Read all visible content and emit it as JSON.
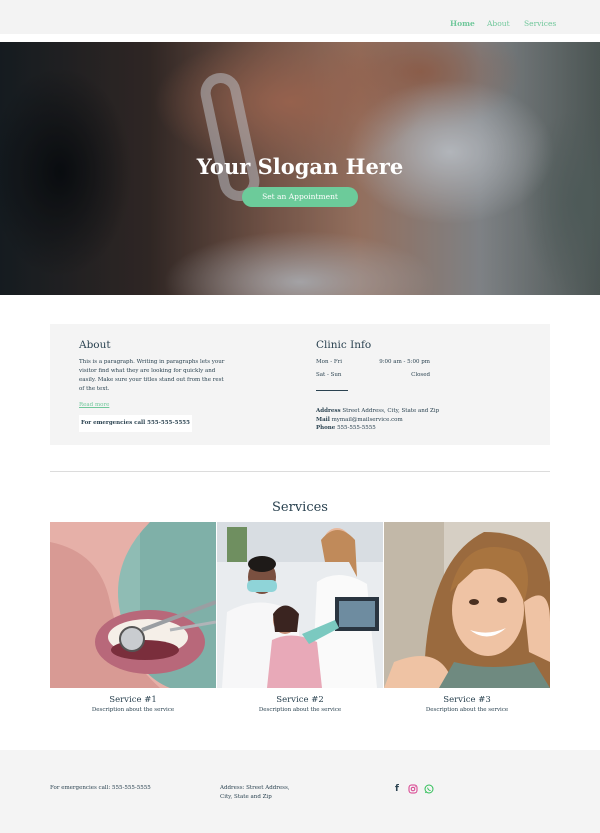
{
  "nav": {
    "items": [
      {
        "label": "Home",
        "active": true
      },
      {
        "label": "About",
        "active": false
      },
      {
        "label": "Services",
        "active": false
      }
    ],
    "accent_color": "#6fc79a"
  },
  "hero": {
    "title": "Your Slogan Here",
    "button_label": "Set an Appointment",
    "button_color": "#6ccb9a"
  },
  "about": {
    "heading": "About",
    "paragraph": "This is a paragraph. Writing in paragraphs lets your visitor find what they are looking for quickly and easily. Make sure your titles stand out from the rest of the text.",
    "read_more": "Read more",
    "emergency_button": "For emergencies call 555-555-5555"
  },
  "clinic": {
    "heading": "Clinic Info",
    "hours": [
      {
        "days": "Mon - Fri",
        "time": "9:00 am - 5:00 pm"
      },
      {
        "days": "Sat - Sun",
        "time": "Closed"
      }
    ],
    "address_label": "Address",
    "address_value": "Street Address, City, State and Zip",
    "mail_label": "Mail",
    "mail_value": "mymail@mailservice.com",
    "phone_label": "Phone",
    "phone_value": "555-555-5555"
  },
  "services": {
    "heading": "Services",
    "items": [
      {
        "name": "Service #1",
        "description": "Description about the service"
      },
      {
        "name": "Service #2",
        "description": "Description about the service"
      },
      {
        "name": "Service #3",
        "description": "Description about the service"
      }
    ]
  },
  "footer": {
    "emergency": "For emergencies call: 555-555-5555",
    "address": "Address: Street Address, City, State and Zip",
    "social_icons": [
      "facebook-icon",
      "instagram-icon",
      "whatsapp-icon"
    ]
  },
  "colors": {
    "text": "#2a4250",
    "panel": "#f4f4f4"
  }
}
